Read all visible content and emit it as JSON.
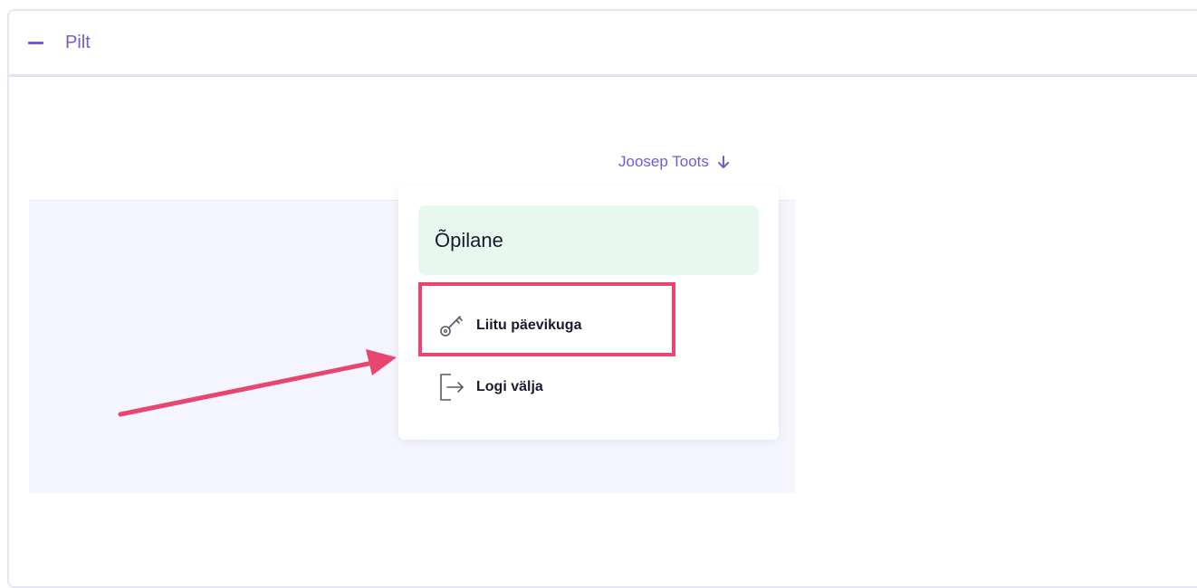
{
  "panel": {
    "title": "Pilt",
    "toggle_icon": "minus-icon"
  },
  "user_menu": {
    "name": "Joosep Toots",
    "arrow_icon": "arrow-down-icon"
  },
  "dropdown": {
    "role": "Õpilane",
    "items": [
      {
        "label": "Liitu päevikuga",
        "icon": "key-icon"
      },
      {
        "label": "Logi välja",
        "icon": "logout-icon"
      }
    ]
  },
  "colors": {
    "accent": "#6a5fd0",
    "role_bg": "#e9f8ef",
    "highlight": "#e8466f",
    "image_bg": "#f4f5fe"
  }
}
